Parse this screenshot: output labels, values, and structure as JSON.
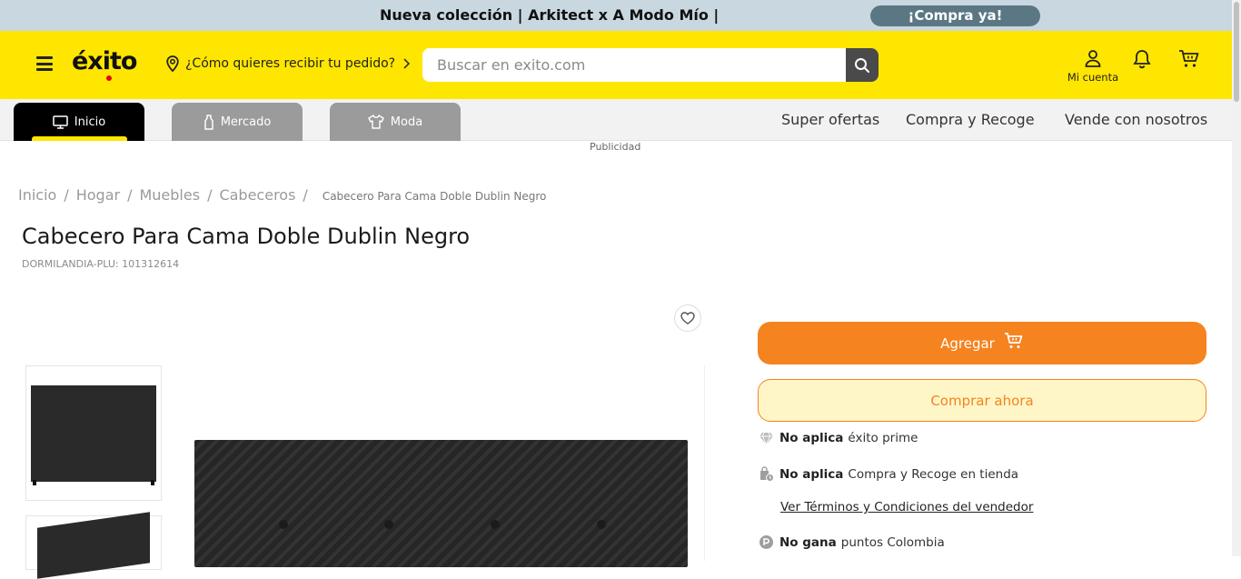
{
  "promo": {
    "text": "Nueva colección | Arkitect x A Modo Mío |",
    "cta": "¡Compra ya!"
  },
  "header": {
    "logo": "éxito",
    "location_prompt": "¿Cómo quieres recibir tu pedido?",
    "search_placeholder": "Buscar en exito.com",
    "account_label": "Mi cuenta"
  },
  "nav": {
    "tabs": [
      {
        "label": "Inicio",
        "icon": "monitor-icon"
      },
      {
        "label": "Mercado",
        "icon": "bottle-icon"
      },
      {
        "label": "Moda",
        "icon": "shirt-icon"
      }
    ],
    "links": [
      "Super ofertas",
      "Compra y Recoge",
      "Vende con nosotros"
    ]
  },
  "ad_label": "Publicidad",
  "breadcrumb": {
    "items": [
      "Inicio",
      "Hogar",
      "Muebles",
      "Cabeceros"
    ],
    "current": "Cabecero Para Cama Doble Dublin Negro"
  },
  "product": {
    "title": "Cabecero Para Cama Doble Dublin Negro",
    "plu": "DORMILANDIA-PLU: 101312614"
  },
  "actions": {
    "add_label": "Agregar",
    "buy_now_label": "Comprar ahora"
  },
  "info": {
    "prime_bold": "No aplica",
    "prime_text": "éxito prime",
    "pickup_bold": "No aplica",
    "pickup_text": "Compra y Recoge en tienda",
    "terms_link": "Ver Términos y Condiciones del vendedor",
    "points_bold": "No gana",
    "points_text": "puntos Colombia"
  },
  "colors": {
    "brand_yellow": "#ffe600",
    "accent_orange": "#f58320",
    "promo_bg": "#c9d7e0"
  }
}
